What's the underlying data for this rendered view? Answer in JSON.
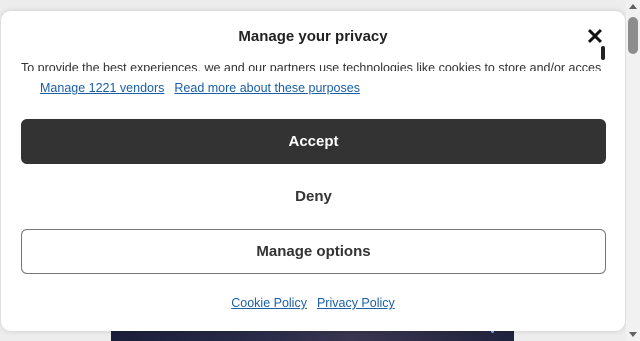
{
  "dialog": {
    "title": "Manage your privacy",
    "description": "To provide the best experiences, we and our partners use technologies like cookies to store and/or access device information.",
    "vendors_link": "Manage 1221 vendors",
    "purposes_link": "Read more about these purposes",
    "accept_label": "Accept",
    "deny_label": "Deny",
    "manage_options_label": "Manage options",
    "cookie_policy_link": "Cookie Policy",
    "privacy_policy_link": "Privacy Policy"
  },
  "icons": {
    "close": "close-icon"
  },
  "colors": {
    "accept_bg": "#333333",
    "link": "#1a5fa8",
    "modal_bg": "#ffffff"
  }
}
